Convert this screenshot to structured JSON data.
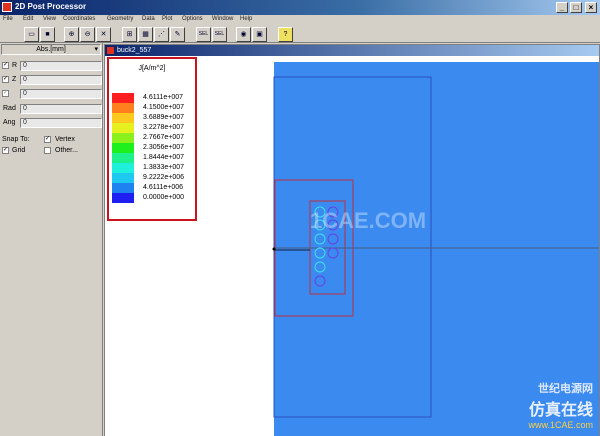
{
  "window": {
    "title": "2D Post Processor",
    "minimize": "_",
    "maximize": "□",
    "close": "×"
  },
  "menu": [
    "File",
    "Edit",
    "View",
    "Coordinates",
    "Geometry",
    "Data",
    "Plot",
    "Options",
    "Window",
    "Help"
  ],
  "toolbar": {
    "buttons": [
      {
        "icon": "open-folder-icon",
        "glyph": "▭"
      },
      {
        "icon": "save-icon",
        "glyph": "■"
      },
      {
        "icon": "zoom-in-icon",
        "glyph": "⊕"
      },
      {
        "icon": "zoom-out-icon",
        "glyph": "⊖"
      },
      {
        "icon": "fit-icon",
        "glyph": "✕"
      },
      {
        "icon": "select-icon",
        "glyph": "⊞"
      },
      {
        "icon": "grid-icon",
        "glyph": "▦"
      },
      {
        "icon": "vector-icon",
        "glyph": "⋰"
      },
      {
        "icon": "draw-icon",
        "glyph": "✎"
      },
      {
        "icon": "sel-icon",
        "glyph": "SEL"
      },
      {
        "icon": "sel2-icon",
        "glyph": "SEL"
      },
      {
        "icon": "view-icon",
        "glyph": "◉"
      },
      {
        "icon": "window-icon",
        "glyph": "▣"
      },
      {
        "icon": "help-icon",
        "glyph": "?"
      }
    ]
  },
  "panel": {
    "units": "Abs.[mm]",
    "units_arrow": "▾",
    "fields": [
      {
        "check": "✓",
        "label": "R",
        "value": "0"
      },
      {
        "check": "✓",
        "label": "Z",
        "value": "0"
      },
      {
        "check": "✓",
        "label": "",
        "value": "0"
      }
    ],
    "rad": {
      "label": "Rad",
      "value": "0"
    },
    "ang": {
      "label": "Ang",
      "value": "0"
    },
    "snap_to": "Snap To:",
    "vertex": "Vertex",
    "grid": "Grid",
    "other": "Other..."
  },
  "doc": {
    "title": "buck2_557"
  },
  "legend": {
    "title": "J[A/m^2]",
    "entries": [
      {
        "color": "#ff1e1e",
        "value": "4.6111e+007"
      },
      {
        "color": "#ff7f1e",
        "value": "4.1500e+007"
      },
      {
        "color": "#ffc81e",
        "value": "3.6889e+007"
      },
      {
        "color": "#e6f01e",
        "value": "3.2278e+007"
      },
      {
        "color": "#8cf01e",
        "value": "2.7667e+007"
      },
      {
        "color": "#1ef01e",
        "value": "2.3056e+007"
      },
      {
        "color": "#1ef08c",
        "value": "1.8444e+007"
      },
      {
        "color": "#1ef0dc",
        "value": "1.3833e+007"
      },
      {
        "color": "#1ec8f0",
        "value": "9.2222e+006"
      },
      {
        "color": "#1e82f0",
        "value": "4.6111e+006"
      },
      {
        "color": "#1e1ef0",
        "value": "0.0000e+000"
      }
    ]
  },
  "watermark": "1CAE.COM",
  "brand": {
    "cn1": "世纪电源网",
    "cn2": "仿真在线",
    "site": "www.1CAE.com"
  }
}
